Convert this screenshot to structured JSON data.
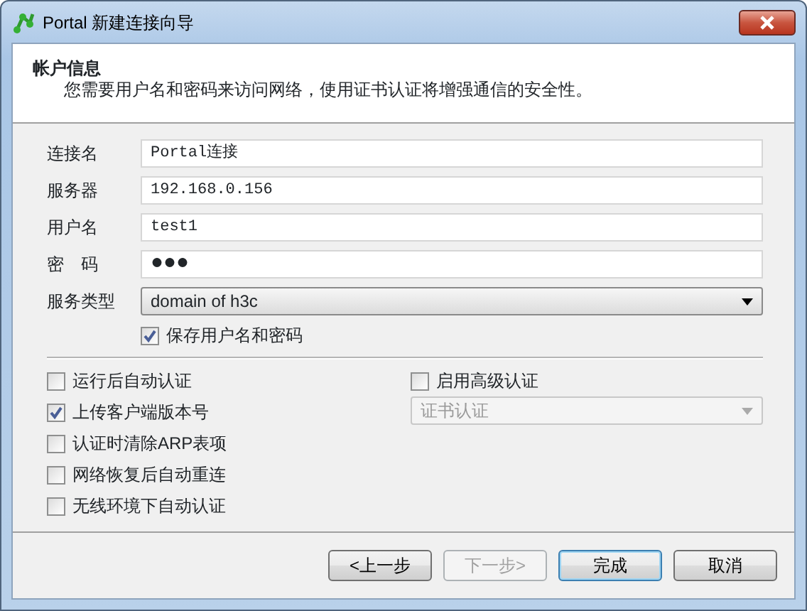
{
  "window": {
    "title": "Portal 新建连接向导"
  },
  "header": {
    "title": "帐户信息",
    "subtitle": "您需要用户名和密码来访问网络，使用证书认证将增强通信的安全性。"
  },
  "fields": [
    {
      "label": "连接名",
      "value": "Portal连接",
      "kind": "text"
    },
    {
      "label": "服务器",
      "value": "192.168.0.156",
      "kind": "text"
    },
    {
      "label": "用户名",
      "value": "test1",
      "kind": "text"
    },
    {
      "label": "密　码",
      "value": "●●●",
      "kind": "password"
    },
    {
      "label": "服务类型",
      "value": "domain of h3c",
      "kind": "select"
    }
  ],
  "save_credentials": {
    "label": "保存用户名和密码",
    "checked": true
  },
  "options": [
    {
      "label": "运行后自动认证",
      "checked": false
    },
    {
      "label": "上传客户端版本号",
      "checked": true
    },
    {
      "label": "认证时清除ARP表项",
      "checked": false
    },
    {
      "label": "网络恢复后自动重连",
      "checked": false
    },
    {
      "label": "无线环境下自动认证",
      "checked": false
    }
  ],
  "advanced": {
    "label": "启用高级认证",
    "checked": false,
    "method": "证书认证",
    "method_disabled": true
  },
  "buttons": [
    {
      "label": "<上一步",
      "disabled": false,
      "default": false
    },
    {
      "label": "下一步>",
      "disabled": true,
      "default": false
    },
    {
      "label": "完成",
      "disabled": false,
      "default": true
    },
    {
      "label": "取消",
      "disabled": false,
      "default": false
    }
  ]
}
